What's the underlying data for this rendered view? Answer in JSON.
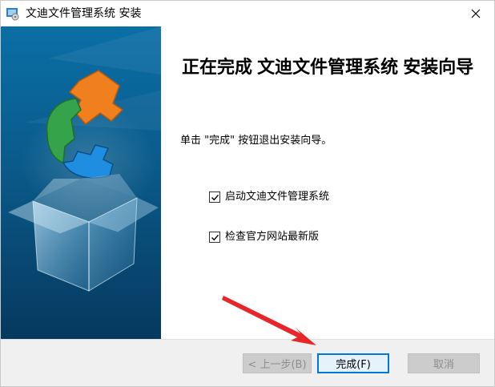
{
  "window": {
    "title": "文迪文件管理系统 安装"
  },
  "content": {
    "heading": "正在完成 文迪文件管理系统 安装向导",
    "description": "单击 \"完成\" 按钮退出安装向导。",
    "options": [
      {
        "label": "启动文迪文件管理系统",
        "checked": true
      },
      {
        "label": "检查官方网站最新版",
        "checked": true
      }
    ]
  },
  "buttons": {
    "back": "< 上一步(B)",
    "finish": "完成(F)",
    "cancel": "取消"
  },
  "colors": {
    "banner_top": "#0a6fa6",
    "banner_bottom": "#06395e",
    "focus_border": "#0078d7",
    "annotation": "#e8262a"
  },
  "icons": {
    "window": "installer-icon",
    "close": "close-icon",
    "checkbox": "checkmark-icon",
    "banner": "puzzle-box-illustration"
  }
}
